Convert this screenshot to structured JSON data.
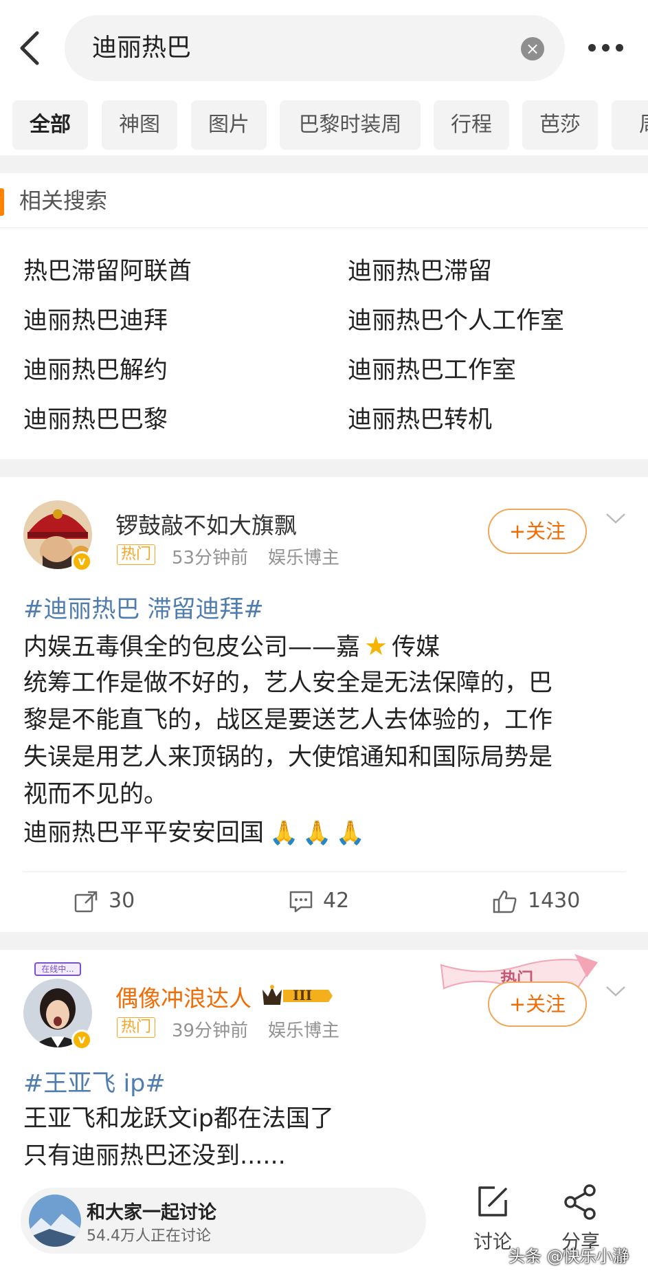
{
  "search": {
    "query": "迪丽热巴"
  },
  "tabs": [
    "全部",
    "神图",
    "图片",
    "巴黎时装周",
    "行程",
    "芭莎",
    "周"
  ],
  "related": {
    "title": "相关搜索",
    "items": [
      "热巴滞留阿联酋",
      "迪丽热巴滞留",
      "迪丽热巴迪拜",
      "迪丽热巴个人工作室",
      "迪丽热巴解约",
      "迪丽热巴工作室",
      "迪丽热巴巴黎",
      "迪丽热巴转机"
    ]
  },
  "post1": {
    "username": "锣鼓敲不如大旗飘",
    "hot_tag": "热门",
    "time": "53分钟前",
    "role": "娱乐博主",
    "follow": "+关注",
    "hashtag": "#迪丽热巴 滞留迪拜#",
    "lines": [
      "内娱五毒俱全的包皮公司——嘉",
      "传媒",
      "统筹工作是做不好的，艺人安全是无法保障的，巴",
      "黎是不能直飞的，战区是要送艺人去体验的，工作",
      "失误是用艺人来顶锅的，大使馆通知和国际局势是",
      "视而不见的。",
      "迪丽热巴平平安安回国"
    ],
    "reposts": "30",
    "comments": "42",
    "likes": "1430"
  },
  "post2": {
    "username": "偶像冲浪达人",
    "level": "III",
    "avatar_label": "在线中...",
    "corner_label": "热门",
    "hot_tag": "热门",
    "time": "39分钟前",
    "role": "娱乐博主",
    "follow": "+关注",
    "hashtag": "#王亚飞 ip#",
    "lines": [
      "王亚飞和龙跃文ip都在法国了",
      "只有迪丽热巴还没到......"
    ]
  },
  "bottom": {
    "discuss_title": "和大家一起讨论",
    "discuss_sub": "54.4万人正在讨论",
    "discuss_label": "讨论",
    "share_label": "分享",
    "watermark": "头条 @快乐小瀞"
  },
  "colors": {
    "accent": "#ff8200",
    "link": "#507daf",
    "follow": "#f26c05",
    "hot": "#f5a623"
  }
}
